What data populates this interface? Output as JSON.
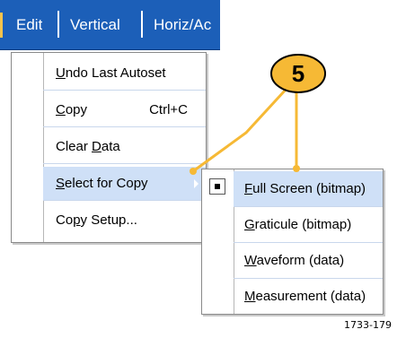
{
  "menubar": {
    "items": [
      {
        "label": "Edit"
      },
      {
        "label": "Vertical"
      },
      {
        "label": "Horiz/Ac"
      }
    ]
  },
  "edit_menu": {
    "items": [
      {
        "label": "Undo Last Autoset",
        "shortcut": ""
      },
      {
        "label": "Copy",
        "shortcut": "Ctrl+C"
      },
      {
        "label": "Clear Data",
        "shortcut": ""
      },
      {
        "label": "Select for Copy",
        "shortcut": "",
        "has_submenu": true,
        "highlighted": true
      },
      {
        "label": "Copy Setup...",
        "shortcut": ""
      }
    ]
  },
  "select_for_copy_submenu": {
    "items": [
      {
        "label": "Full Screen (bitmap)",
        "selected": true,
        "highlighted": true
      },
      {
        "label": "Graticule (bitmap)",
        "selected": false
      },
      {
        "label": "Waveform (data)",
        "selected": false
      },
      {
        "label": "Measurement (data)",
        "selected": false
      }
    ]
  },
  "callout": {
    "step_number": "5",
    "color": "#f6b935"
  },
  "figure_id": "1733-179",
  "colors": {
    "menubar_bg": "#1c5fb8",
    "highlight_bg": "#cfe0f7",
    "accent": "#f6c34d"
  }
}
